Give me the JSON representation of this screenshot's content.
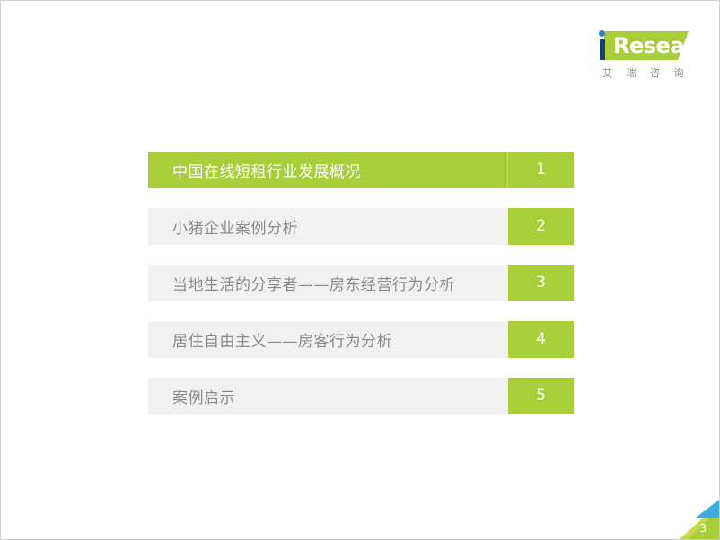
{
  "slide": {
    "background_color": "#ffffff",
    "page_number": "3"
  },
  "logo": {
    "icon": "iresearch-logo",
    "wordmark": "Research",
    "i_letter": "i",
    "subtitle": "艾 瑞 咨 询",
    "green_color": "#A8CE3A",
    "blue_color": "#2F80C2",
    "navy_color": "#1A3F6B",
    "subtitle_color": "#8D8D8D"
  },
  "agenda": {
    "accent_color": "#A8CE3A",
    "row_background": "#F1F1F1",
    "text_color": "#8A8A8A",
    "active_text_color": "#FFFFFF",
    "items": [
      {
        "label": "中国在线短租行业发展概况",
        "number": "1",
        "active": true
      },
      {
        "label": "小猪企业案例分析",
        "number": "2",
        "active": false
      },
      {
        "label": "当地生活的分享者——房东经营行为分析",
        "number": "3",
        "active": false
      },
      {
        "label": "居住自由主义——房客行为分析",
        "number": "4",
        "active": false
      },
      {
        "label": "案例启示",
        "number": "5",
        "active": false
      }
    ]
  },
  "corner": {
    "icon": "page-corner-decoration",
    "page_number": "3",
    "blue_color": "#3FA9E0",
    "green_color": "#A8CE3A",
    "yellow_green_color": "#C7D94A"
  }
}
